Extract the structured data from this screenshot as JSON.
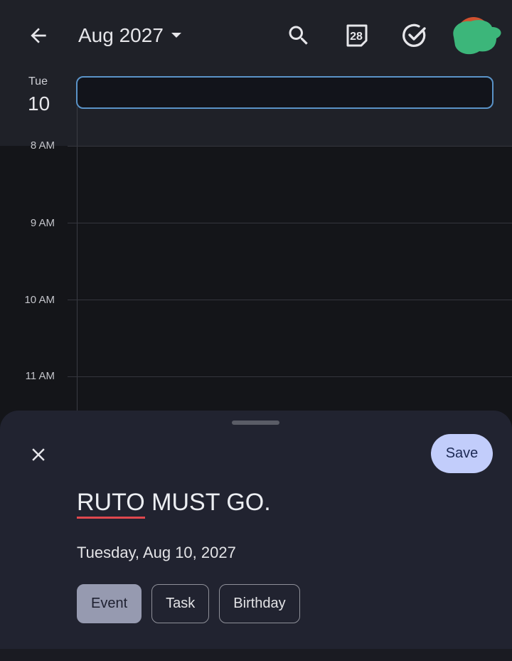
{
  "header": {
    "back_icon": "arrow-left-icon",
    "month_title": "Aug 2027",
    "dropdown_icon": "caret-down-icon",
    "search_icon": "search-icon",
    "today_icon_number": "28",
    "tasks_icon": "check-circle-icon",
    "avatar_color": "#3cb67a"
  },
  "day": {
    "weekday": "Tue",
    "number": "10"
  },
  "event_input": {
    "value": ""
  },
  "time_grid": {
    "hours": [
      "8 AM",
      "9 AM",
      "10 AM",
      "11 AM"
    ]
  },
  "sheet": {
    "close_icon": "close-icon",
    "save_label": "Save",
    "title_misspelled": "RUTO",
    "title_rest": " MUST GO.",
    "date": "Tuesday, Aug 10, 2027",
    "chips": [
      {
        "label": "Event",
        "selected": true
      },
      {
        "label": "Task",
        "selected": false
      },
      {
        "label": "Birthday",
        "selected": false
      }
    ]
  },
  "colors": {
    "accent_border": "#5a93c8",
    "save_bg": "#c2cdfb",
    "spellcheck": "#e0484e"
  }
}
